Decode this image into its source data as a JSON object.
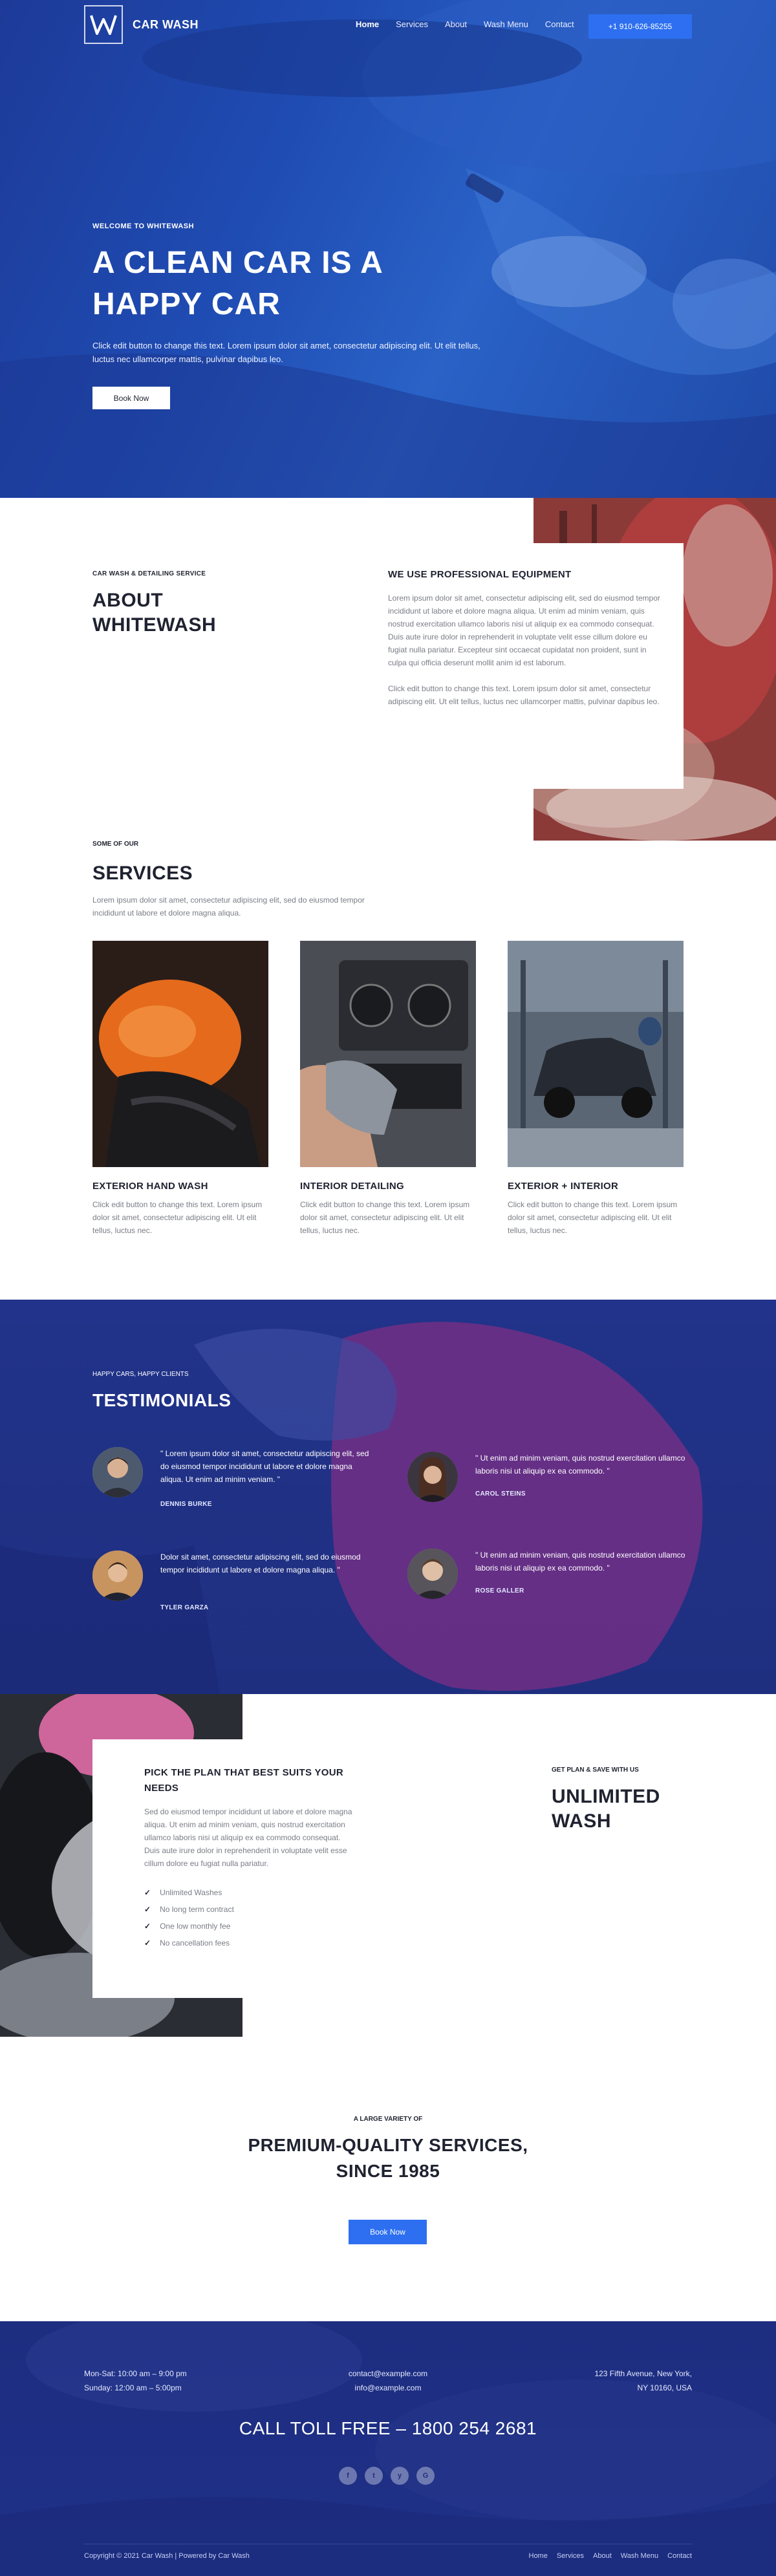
{
  "brand": {
    "name": "CAR WASH",
    "logo_letter": "W"
  },
  "nav": {
    "items": [
      "Home",
      "Services",
      "About",
      "Wash Menu",
      "Contact"
    ],
    "phone": "+1 910-626-85255"
  },
  "hero": {
    "kicker": "WELCOME TO WHITEWASH",
    "title_line1": "A CLEAN CAR IS A",
    "title_line2": "HAPPY CAR",
    "text": "Click edit button to change this text. Lorem ipsum dolor sit amet, consectetur adipiscing elit. Ut elit tellus, luctus nec ullamcorper mattis, pulvinar dapibus leo.",
    "button": "Book Now"
  },
  "about": {
    "kicker": "CAR WASH & DETAILING SERVICE",
    "title_line1": "ABOUT",
    "title_line2": "WHITEWASH",
    "card_title": "WE USE PROFESSIONAL EQUIPMENT",
    "paragraph1": "Lorem ipsum dolor sit amet, consectetur adipiscing elit, sed do eiusmod tempor incididunt ut labore et dolore magna aliqua. Ut enim ad minim veniam, quis nostrud exercitation ullamco laboris nisi ut aliquip ex ea commodo consequat. Duis aute irure dolor in reprehenderit in voluptate velit esse cillum dolore eu fugiat nulla pariatur. Excepteur sint occaecat cupidatat non proident, sunt in culpa qui officia deserunt mollit anim id est laborum.",
    "paragraph2": "Click edit button to change this text. Lorem ipsum dolor sit amet, consectetur adipiscing elit. Ut elit tellus, luctus nec ullamcorper mattis, pulvinar dapibus leo."
  },
  "services": {
    "kicker": "SOME OF OUR",
    "title": "SERVICES",
    "intro": "Lorem ipsum dolor sit amet, consectetur adipiscing elit, sed do eiusmod tempor incididunt ut labore et dolore magna aliqua.",
    "items": [
      {
        "title": "EXTERIOR HAND WASH",
        "text": "Click edit button to change this text. Lorem ipsum dolor sit amet, consectetur adipiscing elit. Ut elit tellus, luctus nec."
      },
      {
        "title": "INTERIOR DETAILING",
        "text": "Click edit button to change this text. Lorem ipsum dolor sit amet, consectetur adipiscing elit. Ut elit tellus, luctus nec."
      },
      {
        "title": "EXTERIOR + INTERIOR",
        "text": "Click edit button to change this text. Lorem ipsum dolor sit amet, consectetur adipiscing elit. Ut elit tellus, luctus nec."
      }
    ]
  },
  "testimonials": {
    "kicker": "HAPPY CARS, HAPPY CLIENTS",
    "title": "TESTIMONIALS",
    "items": [
      {
        "quote": "\" Lorem ipsum dolor sit amet, consectetur adipiscing elit, sed do eiusmod tempor incididunt ut labore et dolore magna aliqua. Ut enim ad minim veniam. \"",
        "name": "DENNIS BURKE"
      },
      {
        "quote": "\" Ut enim ad minim veniam, quis nostrud exercitation ullamco laboris nisi ut aliquip ex ea commodo. \"",
        "name": "CAROL STEINS"
      },
      {
        "quote": "Dolor sit amet, consectetur adipiscing elit, sed do eiusmod tempor incididunt ut labore et dolore magna aliqua. \"",
        "name": "TYLER GARZA"
      },
      {
        "quote": "\" Ut enim ad minim veniam, quis nostrud exercitation ullamco laboris nisi ut aliquip ex ea commodo. \"",
        "name": "ROSE GALLER"
      }
    ]
  },
  "pricing": {
    "card_title": "PICK THE PLAN THAT BEST SUITS YOUR NEEDS",
    "text": "Sed do eiusmod tempor incididunt ut labore et dolore magna aliqua. Ut enim ad minim veniam, quis nostrud exercitation ullamco laboris nisi ut aliquip ex ea commodo consequat. Duis aute irure dolor in reprehenderit in voluptate velit esse cillum dolore eu fugiat nulla pariatur.",
    "features": [
      "Unlimited Washes",
      "No long term contract",
      "One low monthly fee",
      "No cancellation fees"
    ],
    "kicker": "GET PLAN & SAVE WITH US",
    "title_line1": "UNLIMITED",
    "title_line2": "WASH"
  },
  "cta": {
    "kicker": "A LARGE VARIETY OF",
    "title_line1": "PREMIUM-QUALITY SERVICES,",
    "title_line2": "SINCE 1985",
    "button": "Book Now"
  },
  "footer": {
    "hours_line1": "Mon-Sat: 10:00 am – 9:00 pm",
    "hours_line2": "Sunday: 12:00 am – 5:00pm",
    "email1": "contact@example.com",
    "email2": "info@example.com",
    "address_line1": "123 Fifth Avenue, New York,",
    "address_line2": "NY 10160, USA",
    "call": "CALL TOLL FREE – 1800 254 2681",
    "social": [
      "f",
      "t",
      "y",
      "G"
    ],
    "copyright": "Copyright © 2021 Car Wash | Powered by Car Wash",
    "nav": [
      "Home",
      "Services",
      "About",
      "Wash Menu",
      "Contact"
    ]
  }
}
